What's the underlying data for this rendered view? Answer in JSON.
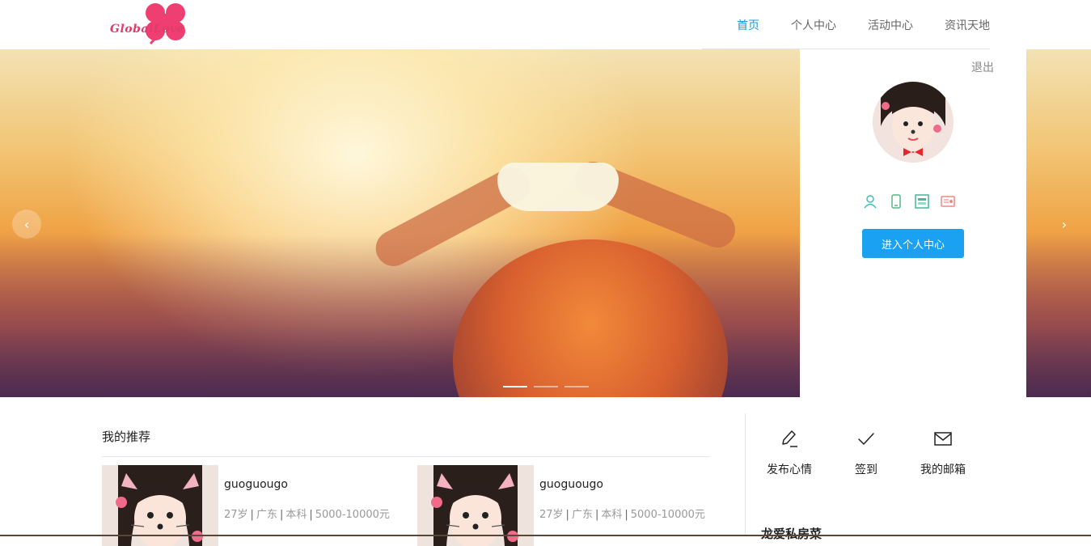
{
  "logo": {
    "text": "GlobalLove"
  },
  "nav": {
    "items": [
      {
        "label": "首页",
        "active": true
      },
      {
        "label": "个人中心",
        "active": false
      },
      {
        "label": "活动中心",
        "active": false
      },
      {
        "label": "资讯天地",
        "active": false
      }
    ]
  },
  "banner": {
    "prev_icon": "‹",
    "next_icon": "›",
    "slide_count": 3,
    "active_slide": 1
  },
  "user_card": {
    "logout": "退出",
    "icons": [
      "user-icon",
      "phone-icon",
      "id-card-icon",
      "certificate-icon"
    ],
    "enter_button": "进入个人中心"
  },
  "recommend": {
    "title": "我的推荐",
    "cards": [
      {
        "name": "guoguougo",
        "age": "27岁",
        "region": "广东",
        "education": "本科",
        "income": "5000-10000元"
      },
      {
        "name": "guoguougo",
        "age": "27岁",
        "region": "广东",
        "education": "本科",
        "income": "5000-10000元"
      }
    ]
  },
  "actions": [
    {
      "label": "发布心情",
      "icon": "pencil-icon"
    },
    {
      "label": "签到",
      "icon": "check-icon"
    },
    {
      "label": "我的邮箱",
      "icon": "mail-icon"
    }
  ],
  "sidebar": {
    "heading": "龙爱私房菜"
  },
  "colors": {
    "accent": "#1a9bd8",
    "button": "#1ba1f2",
    "logo": "#e23a6a"
  }
}
